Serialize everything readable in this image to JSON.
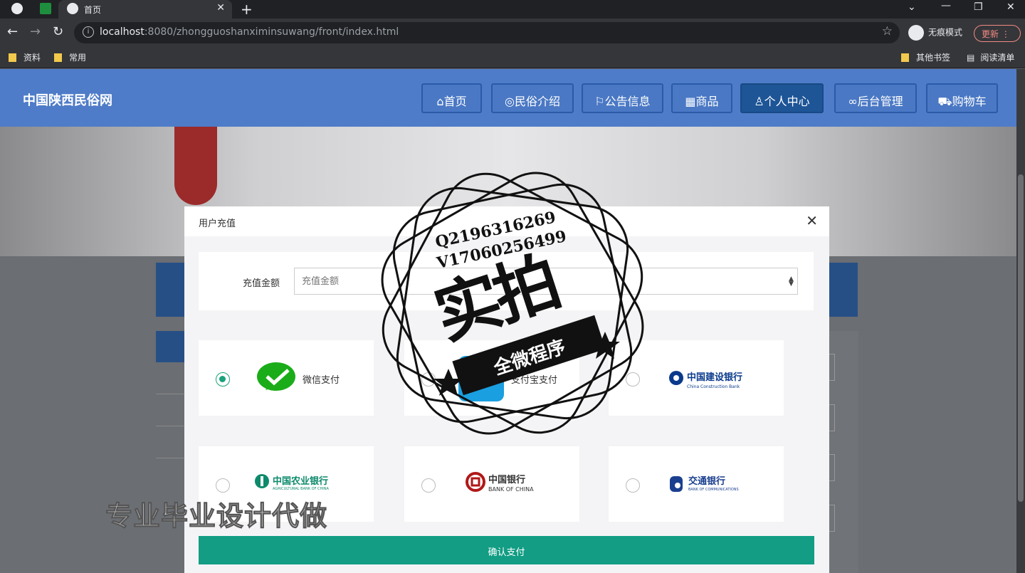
{
  "browser": {
    "tab_title": "首页",
    "url_host": "localhost",
    "url_rest": ":8080/zhongguoshanximinsuwang/front/index.html",
    "incognito_label": "无痕模式",
    "update_label": "更新",
    "bookmarks": [
      "资料",
      "常用"
    ],
    "bookmarks_right": [
      "其他书签",
      "阅读清单"
    ]
  },
  "site": {
    "title": "中国陕西民俗网",
    "nav": [
      {
        "label": "首页",
        "icon": "home-icon"
      },
      {
        "label": "民俗介绍",
        "icon": "palette-icon"
      },
      {
        "label": "公告信息",
        "icon": "flag-icon"
      },
      {
        "label": "商品",
        "icon": "calendar-icon"
      },
      {
        "label": "个人中心",
        "icon": "user-icon"
      },
      {
        "label": "后台管理",
        "icon": "link-icon"
      },
      {
        "label": "购物车",
        "icon": "cart-icon"
      }
    ],
    "active_nav": "个人中心"
  },
  "modal": {
    "title": "用户充值",
    "amount_label": "充值金额",
    "amount_placeholder": "充值金额",
    "payments": [
      {
        "label": "微信支付",
        "selected": true
      },
      {
        "label": "支付宝支付",
        "selected": false
      },
      {
        "label": "中国建设银行",
        "selected": false
      },
      {
        "label": "中国农业银行",
        "selected": false
      },
      {
        "label": "中国银行",
        "selected": false
      },
      {
        "label": "交通银行",
        "selected": false
      }
    ],
    "bank_logo_text": {
      "ccb_en": "China Construction Bank",
      "boc_en": "BANK OF CHINA",
      "bocom_en": "BANK OF COMMUNICATIONS",
      "abc_en": "AGRICULTURAL BANK OF CHINA"
    },
    "confirm_label": "确认支付"
  },
  "watermark": {
    "bottom_text": "专业毕业设计代做",
    "stamp_line1": "Q2196316269",
    "stamp_line2": "V17060256499",
    "stamp_big": "实拍",
    "stamp_ribbon": "全微程序"
  },
  "colors": {
    "header": "#4f7cc8",
    "active_nav": "#1d5596",
    "confirm": "#129d84",
    "radio_selected": "#1aa27a"
  }
}
